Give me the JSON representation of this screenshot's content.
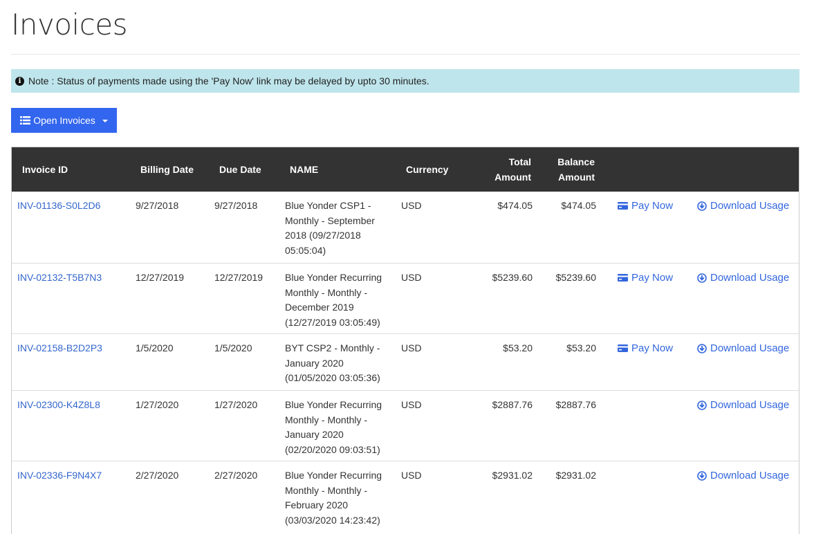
{
  "page": {
    "title": "Invoices",
    "note": "Note : Status of payments made using the 'Pay Now' link may be delayed by upto 30 minutes.",
    "filter_button": "Open Invoices"
  },
  "table": {
    "headers": {
      "invoice_id": "Invoice ID",
      "billing_date": "Billing Date",
      "due_date": "Due Date",
      "name": "NAME",
      "currency": "Currency",
      "total_amount_1": "Total",
      "total_amount_2": "Amount",
      "balance_amount_1": "Balance",
      "balance_amount_2": "Amount"
    },
    "pay_now_label": "Pay Now",
    "download_label": "Download Usage",
    "rows": [
      {
        "invoice_id": "INV-01136-S0L2D6",
        "billing_date": "9/27/2018",
        "due_date": "9/27/2018",
        "name_lines": [
          "Blue Yonder CSP1 -",
          "Monthly - September",
          "2018 (09/27/2018",
          "05:05:04)"
        ],
        "currency": "USD",
        "total": "$474.05",
        "balance": "$474.05",
        "pay_now": true
      },
      {
        "invoice_id": "INV-02132-T5B7N3",
        "billing_date": "12/27/2019",
        "due_date": "12/27/2019",
        "name_lines": [
          "Blue Yonder Recurring",
          "Monthly - Monthly -",
          "December 2019",
          "(12/27/2019 03:05:49)"
        ],
        "currency": "USD",
        "total": "$5239.60",
        "balance": "$5239.60",
        "pay_now": true
      },
      {
        "invoice_id": "INV-02158-B2D2P3",
        "billing_date": "1/5/2020",
        "due_date": "1/5/2020",
        "name_lines": [
          "BYT CSP2 - Monthly -",
          "January 2020",
          "(01/05/2020 03:05:36)"
        ],
        "currency": "USD",
        "total": "$53.20",
        "balance": "$53.20",
        "pay_now": true
      },
      {
        "invoice_id": "INV-02300-K4Z8L8",
        "billing_date": "1/27/2020",
        "due_date": "1/27/2020",
        "name_lines": [
          "Blue Yonder Recurring",
          "Monthly - Monthly -",
          "January 2020",
          "(02/20/2020 09:03:51)"
        ],
        "currency": "USD",
        "total": "$2887.76",
        "balance": "$2887.76",
        "pay_now": false
      },
      {
        "invoice_id": "INV-02336-F9N4X7",
        "billing_date": "2/27/2020",
        "due_date": "2/27/2020",
        "name_lines": [
          "Blue Yonder Recurring",
          "Monthly - Monthly -",
          "February 2020",
          "(03/03/2020 14:23:42)"
        ],
        "currency": "USD",
        "total": "$2931.02",
        "balance": "$2931.02",
        "pay_now": false
      }
    ]
  },
  "icons": {
    "info": "info-circle-icon",
    "list": "list-icon",
    "caret": "caret-down-icon",
    "pay": "credit-card-icon",
    "download": "download-circle-icon"
  },
  "colors": {
    "link": "#3366cc",
    "header_bg": "#333333",
    "note_bg": "#bee5eb",
    "button_bg": "#3366ee"
  }
}
